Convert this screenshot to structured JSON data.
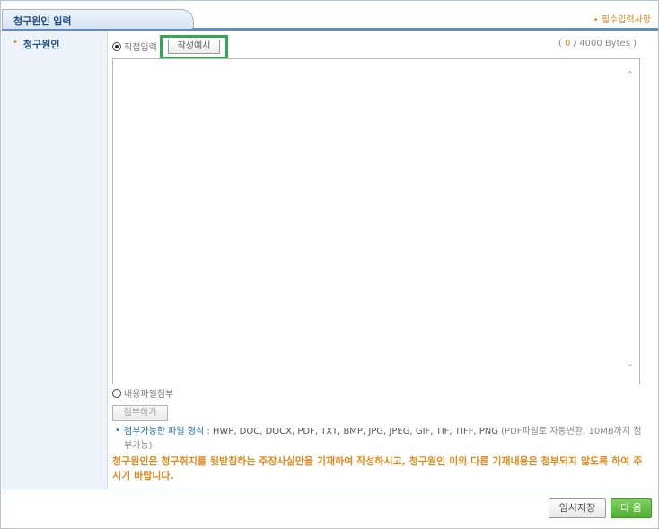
{
  "tab": {
    "title": "청구원인 입력"
  },
  "required_note": "• 필수입력사항",
  "field": {
    "bullet": "•",
    "label": "청구원인"
  },
  "input_mode": {
    "direct_label": "직접입력",
    "example_button": "작성예시",
    "byte_open": "( ",
    "byte_current": "0",
    "byte_rest": " / 4000 Bytes )"
  },
  "textarea": {
    "value": ""
  },
  "file_mode": {
    "label": "내용파일첨부",
    "attach_button": "첨부하기",
    "format_bullet": "•",
    "format_label": "첨부가능한 파일 형식 : ",
    "format_list": "HWP, DOC, DOCX, PDF, TXT, BMP, JPG, JPEG, GIF, TIF, TIFF, PNG",
    "format_note": " (PDF파일로 자동변환, 10MB까지 첨부가능)"
  },
  "notice": "청구원인은 청구취지를 뒷받침하는 주장사실만을 기재하여 작성하시고, 청구원인 이외 다른 기재내용은 첨부되지 않도록 하여 주시기 바랍니다.",
  "buttons": {
    "save": "임시저장",
    "next": "다 음"
  },
  "colors": {
    "accent_orange": "#e08a1e",
    "header_blue": "#1d4f80",
    "next_green": "#4fae33",
    "highlight": "#2fa84f"
  }
}
